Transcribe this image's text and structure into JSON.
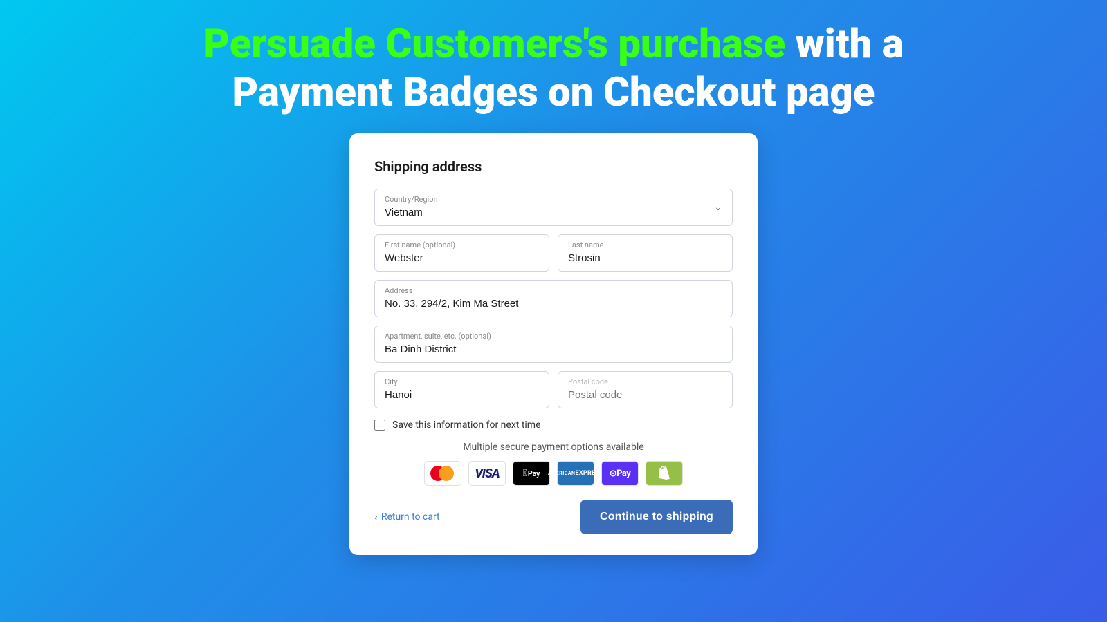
{
  "headline": {
    "line1_green": "Persuade Customers's purchase",
    "line1_white": " with a",
    "line2": "Payment Badges on Checkout page"
  },
  "form": {
    "section_title": "Shipping address",
    "country_label": "Country/Region",
    "country_value": "Vietnam",
    "first_name_label": "First name (optional)",
    "first_name_value": "Webster",
    "last_name_label": "Last name",
    "last_name_value": "Strosin",
    "address_label": "Address",
    "address_value": "No. 33, 294/2, Kim Ma Street",
    "apartment_label": "Apartment, suite, etc. (optional)",
    "apartment_value": "Ba Dinh District",
    "city_label": "City",
    "city_value": "Hanoi",
    "postal_label": "Postal code",
    "postal_value": "",
    "save_label": "Save this information for next time"
  },
  "payment": {
    "label": "Multiple secure payment options available",
    "badges": [
      {
        "name": "Mastercard",
        "type": "mastercard"
      },
      {
        "name": "Visa",
        "type": "visa"
      },
      {
        "name": "Apple Pay",
        "type": "applepay"
      },
      {
        "name": "American Express",
        "type": "amex"
      },
      {
        "name": "GPay",
        "type": "opay"
      },
      {
        "name": "Shopify",
        "type": "shopify"
      }
    ]
  },
  "footer": {
    "return_label": "Return to cart",
    "continue_label": "Continue to shipping"
  }
}
